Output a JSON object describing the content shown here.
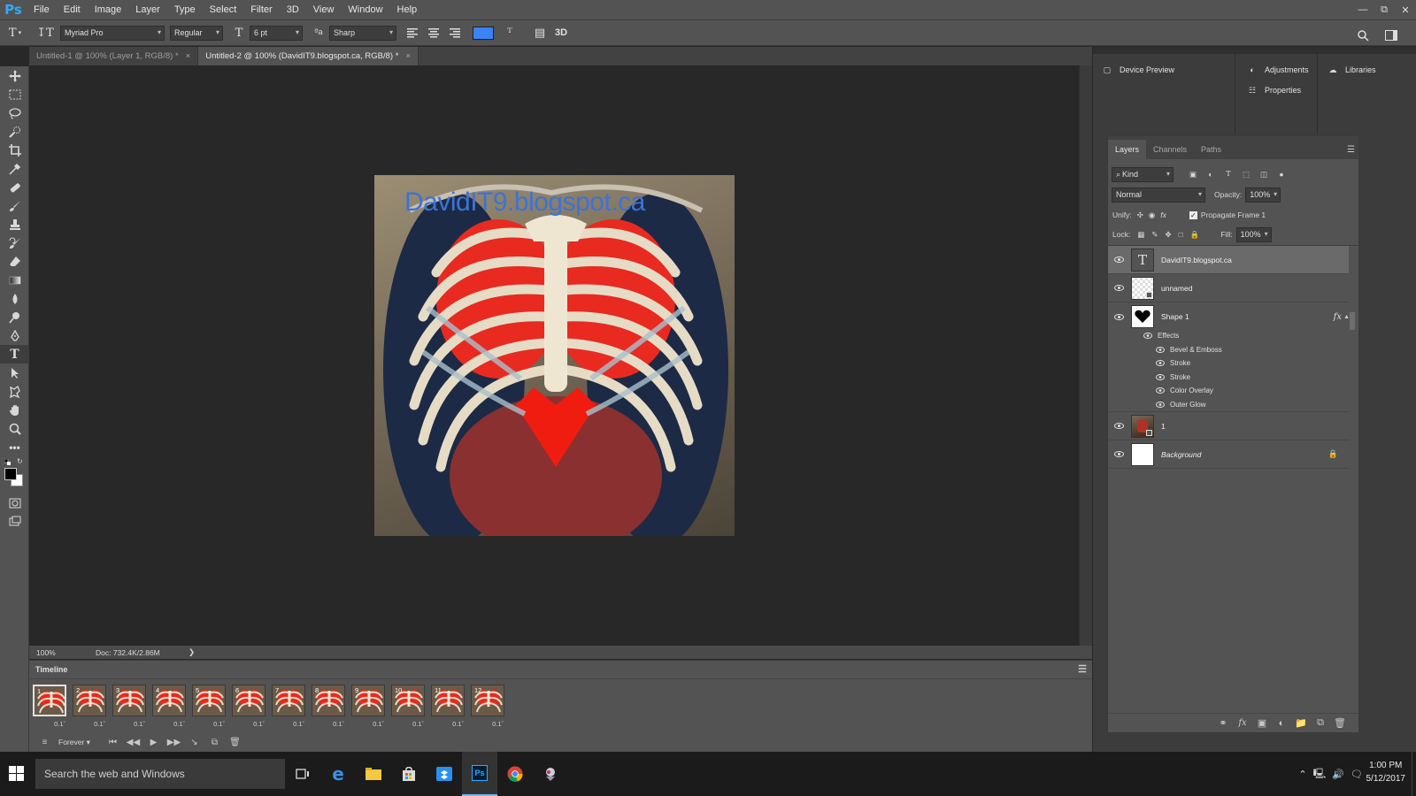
{
  "app": {
    "logo": "Ps"
  },
  "menu": [
    "File",
    "Edit",
    "Image",
    "Layer",
    "Type",
    "Select",
    "Filter",
    "3D",
    "View",
    "Window",
    "Help"
  ],
  "options": {
    "font_family": "Myriad Pro",
    "font_style": "Regular",
    "font_size": "6 pt",
    "antialias_label": "ªa",
    "antialias": "Sharp",
    "text_color": "#3b82f6",
    "three_d": "3D"
  },
  "tabs": [
    {
      "label": "Untitled-1 @ 100% (Layer 1, RGB/8) *",
      "active": false
    },
    {
      "label": "Untitled-2 @ 100% (DavidIT9.blogspot.ca, RGB/8) *",
      "active": true
    }
  ],
  "canvas": {
    "text": "DavidIT9.blogspot.ca",
    "text_color": "#3b73d8"
  },
  "status": {
    "zoom": "100%",
    "doc": "Doc: 732.4K/2.86M"
  },
  "timeline": {
    "title": "Timeline",
    "frames": [
      {
        "num": "1",
        "delay": "0.1"
      },
      {
        "num": "2",
        "delay": "0.1"
      },
      {
        "num": "3",
        "delay": "0.1"
      },
      {
        "num": "4",
        "delay": "0.1"
      },
      {
        "num": "5",
        "delay": "0.1"
      },
      {
        "num": "6",
        "delay": "0.1"
      },
      {
        "num": "7",
        "delay": "0.1"
      },
      {
        "num": "8",
        "delay": "0.1"
      },
      {
        "num": "9",
        "delay": "0.1"
      },
      {
        "num": "10",
        "delay": "0.1"
      },
      {
        "num": "11",
        "delay": "0.1"
      },
      {
        "num": "12",
        "delay": "0.1"
      }
    ],
    "loop": "Forever"
  },
  "panels": {
    "device_preview": "Device Preview",
    "adjustments": "Adjustments",
    "properties": "Properties",
    "libraries": "Libraries"
  },
  "layers_panel": {
    "tabs": [
      "Layers",
      "Channels",
      "Paths"
    ],
    "kind": "Kind",
    "blend_mode": "Normal",
    "opacity_label": "Opacity:",
    "opacity": "100%",
    "unify_label": "Unify:",
    "propagate": "Propagate Frame 1",
    "lock_label": "Lock:",
    "fill_label": "Fill:",
    "fill": "100%",
    "layers": [
      {
        "name": "DavidIT9.blogspot.ca",
        "type": "text",
        "selected": true
      },
      {
        "name": "unnamed",
        "type": "image"
      },
      {
        "name": "Shape 1",
        "type": "shape",
        "fx": "fx"
      },
      {
        "name": "1",
        "type": "image"
      },
      {
        "name": "Background",
        "type": "background"
      }
    ],
    "effects_label": "Effects",
    "effects": [
      "Bevel & Emboss",
      "Stroke",
      "Stroke",
      "Color Overlay",
      "Outer Glow"
    ]
  },
  "taskbar": {
    "search_placeholder": "Search the web and Windows",
    "time": "1:00 PM",
    "date": "5/12/2017"
  }
}
